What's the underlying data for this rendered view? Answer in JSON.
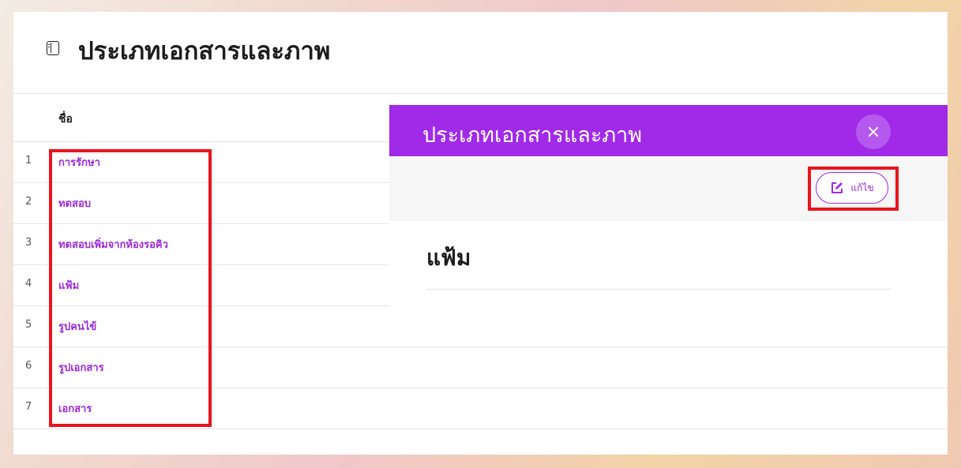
{
  "page": {
    "title": "ประเภทเอกสารและภาพ"
  },
  "table": {
    "column_header": "ชื่อ",
    "rows": [
      {
        "num": "1",
        "name": "การรักษา"
      },
      {
        "num": "2",
        "name": "ทดสอบ"
      },
      {
        "num": "3",
        "name": "ทดสอบเพิ่มจากห้องรอคิว"
      },
      {
        "num": "4",
        "name": "แฟ้ม"
      },
      {
        "num": "5",
        "name": "รูปคนไข้"
      },
      {
        "num": "6",
        "name": "รูปเอกสาร"
      },
      {
        "num": "7",
        "name": "เอกสาร"
      }
    ]
  },
  "panel": {
    "title": "ประเภทเอกสารและภาพ",
    "close_icon": "×",
    "edit_label": "แก้ไข",
    "detail_value": "แฟ้ม"
  },
  "colors": {
    "accent": "#a02ae8",
    "link": "#9b2ad6",
    "highlight": "#e8141e"
  },
  "icons": {
    "page_icon": "sidebar-panel-icon",
    "close": "close-icon",
    "edit": "edit-icon"
  }
}
